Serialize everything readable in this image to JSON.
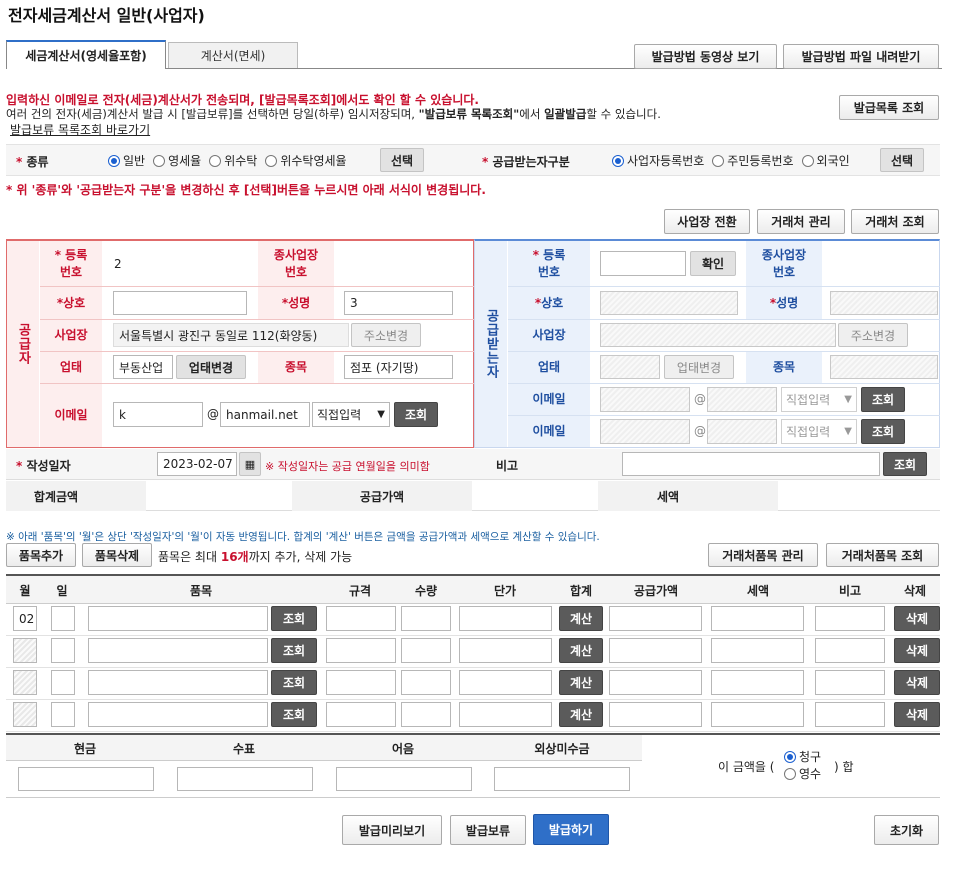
{
  "page_title": "전자세금계산서 일반(사업자)",
  "tabs": [
    {
      "label": "세금계산서(영세율포함)",
      "active": true
    },
    {
      "label": "계산서(면세)",
      "active": false
    }
  ],
  "top_buttons": {
    "video": "발급방법 동영상 보기",
    "download": "발급방법 파일 내려받기",
    "list_query": "발급목록 조회"
  },
  "notice": {
    "line1": "입력하신 이메일로 전자(세금)계산서가 전송되며, [발급목록조회]에서도 확인 할 수 있습니다.",
    "line2_a": "여러 건의 전자(세금)계산서 발급 시 [발급보류]를 선택하면 당일(하루) 임시저장되며, ",
    "line2_b": "\"발급보류 목록조회\"",
    "line2_c": "에서 ",
    "line2_d": "일괄발급",
    "line2_e": "할 수 있습니다.",
    "link": "발급보류 목록조회 바로가기"
  },
  "kind": {
    "label": "종류",
    "options": [
      {
        "label": "일반",
        "selected": true
      },
      {
        "label": "영세율",
        "selected": false
      },
      {
        "label": "위수탁",
        "selected": false
      },
      {
        "label": "위수탁영세율",
        "selected": false
      }
    ],
    "select_btn": "선택"
  },
  "receiver_type": {
    "label": "공급받는자구분",
    "options": [
      {
        "label": "사업자등록번호",
        "selected": true
      },
      {
        "label": "주민등록번호",
        "selected": false
      },
      {
        "label": "외국인",
        "selected": false
      }
    ],
    "select_btn": "선택"
  },
  "change_notice": "* 위 '종류'와 '공급받는자 구분'을 변경하신 후 [선택]버튼을 누르시면 아래 서식이 변경됩니다.",
  "mgmt_buttons": {
    "workplace": "사업장 전환",
    "partner_mgmt": "거래처 관리",
    "partner_query": "거래처 조회"
  },
  "supplier": {
    "side_label": "공급자",
    "reg_no_label": "등록\n번호",
    "reg_no_value": "2",
    "sub_no_label": "종사업장\n번호",
    "name_label": "상호",
    "rep_label": "성명",
    "rep_value": "3",
    "addr_label": "사업장",
    "addr_value": "서울특별시 광진구 동일로 112(화양동)",
    "addr_btn": "주소변경",
    "biz_type_label": "업태",
    "biz_type_value": "부동산업",
    "biz_type_btn": "업태변경",
    "item_label": "종목",
    "item_value": "점포 (자기땅)",
    "email_label": "이메일",
    "email_id": "k",
    "email_domain": "hanmail.net",
    "email_select": "직접입력",
    "email_btn": "조회"
  },
  "receiver": {
    "side_label": "공급받는자",
    "reg_no_label": "등록\n번호",
    "confirm_btn": "확인",
    "sub_no_label": "종사업장\n번호",
    "name_label": "상호",
    "rep_label": "성명",
    "addr_label": "사업장",
    "addr_btn": "주소변경",
    "biz_type_label": "업태",
    "biz_type_btn": "업태변경",
    "item_label": "종목",
    "email_label": "이메일",
    "email_select": "직접입력",
    "email_btn": "조회"
  },
  "date_row": {
    "label": "작성일자",
    "value": "2023-02-07",
    "hint": "※ 작성일자는 공급 연월일을 의미함",
    "note_label": "비고",
    "note_btn": "조회"
  },
  "totals": {
    "total_label": "합계금액",
    "supply_label": "공급가액",
    "tax_label": "세액"
  },
  "items_notice": "※ 아래 '품목'의 '월'은 상단 '작성일자'의 '월'이 자동 반영됩니다. 합계의 '계산' 버튼은 금액을 공급가액과 세액으로 계산할 수 있습니다.",
  "items_toolbar": {
    "add": "품목추가",
    "delete": "품목삭제",
    "hint_a": "품목은 최대 ",
    "hint_b": "16개",
    "hint_c": "까지 추가, 삭제 가능",
    "mgmt": "거래처품목 관리",
    "query": "거래처품목 조회"
  },
  "items_headers": [
    "월",
    "일",
    "품목",
    "규격",
    "수량",
    "단가",
    "합계",
    "공급가액",
    "세액",
    "비고",
    "삭제"
  ],
  "item_rows": [
    {
      "month": "02",
      "query_btn": "조회",
      "calc_btn": "계산",
      "del_btn": "삭제"
    },
    {
      "month": "",
      "query_btn": "조회",
      "calc_btn": "계산",
      "del_btn": "삭제"
    },
    {
      "month": "",
      "query_btn": "조회",
      "calc_btn": "계산",
      "del_btn": "삭제"
    },
    {
      "month": "",
      "query_btn": "조회",
      "calc_btn": "계산",
      "del_btn": "삭제"
    }
  ],
  "payment": {
    "headers": [
      "현금",
      "수표",
      "어음",
      "외상미수금"
    ],
    "sentence_a": "이 금액을 (",
    "sentence_b": ") 합",
    "opt1": "청구",
    "opt2": "영수"
  },
  "bottom_buttons": {
    "preview": "발급미리보기",
    "hold": "발급보류",
    "issue": "발급하기",
    "reset": "초기화"
  },
  "colors": {
    "supplier_border": "#e06b6b",
    "supplier_label_bg": "#fdeeee",
    "receiver_border": "#5b8bd6",
    "receiver_label_bg": "#eaf1fb",
    "issue_btn": "#2f6fc8",
    "notice_red": "#c8102e"
  }
}
